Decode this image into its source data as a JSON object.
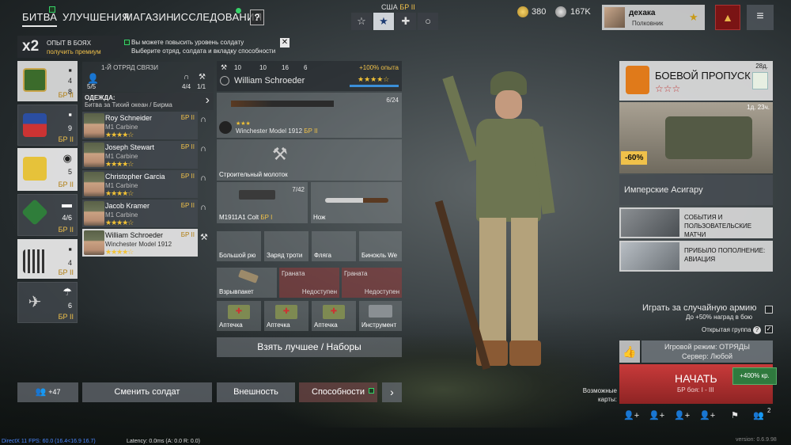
{
  "nav": {
    "battle": "БИТВА",
    "upgrades": "УЛУЧШЕНИЯ",
    "shop": "МАГАЗИН",
    "research": "ИССЛЕДОВАНИЯ",
    "help": "?"
  },
  "army": {
    "name": "США",
    "rank": "БР II"
  },
  "currency": {
    "gold": "380",
    "silver": "167K"
  },
  "profile": {
    "name": "дехака",
    "rank": "Полковник"
  },
  "boost": {
    "x2": "x2",
    "title": "ОПЫТ В БОЯХ",
    "subtitle": "получить премиум"
  },
  "notice": {
    "text": "Вы можете повысить уровень солдату\nВыберите отряд, солдата и вкладку способности"
  },
  "squads": [
    {
      "count": "4",
      "men": "8",
      "rank": "БР II"
    },
    {
      "count": "9",
      "rank": "БР II"
    },
    {
      "count": "5",
      "rank": "БР II"
    },
    {
      "count": "4/6",
      "rank": "БР II"
    },
    {
      "count": "4",
      "rank": "БР II"
    },
    {
      "count": "6",
      "rank": "БР II"
    }
  ],
  "squad_info": {
    "title": "1-Й ОТРЯД СВЯЗИ",
    "size": "5/5",
    "radio": "4/4",
    "eng": "1/1"
  },
  "outfit": {
    "title": "ОДЕЖДА:",
    "subtitle": "Битва за Тихий океан / Бирма"
  },
  "soldiers": [
    {
      "name": "Roy Schneider",
      "weapon": "M1 Carbine",
      "rank": "БР II",
      "stars": "★★★★☆"
    },
    {
      "name": "Joseph Stewart",
      "weapon": "M1 Carbine",
      "rank": "БР II",
      "stars": "★★★★☆"
    },
    {
      "name": "Christopher Garcia",
      "weapon": "M1 Carbine",
      "rank": "БР II",
      "stars": "★★★★☆"
    },
    {
      "name": "Jacob Kramer",
      "weapon": "M1 Carbine",
      "rank": "БР II",
      "stars": "★★★★☆"
    },
    {
      "name": "William Schroeder",
      "weapon": "Winchester Model 1912",
      "rank": "БР II",
      "stars": "★★★★☆"
    }
  ],
  "detail": {
    "stat1": "10",
    "stat2": "10",
    "stat3": "16",
    "stat4": "6",
    "exp": "+100% опыта",
    "name": "William Schroeder",
    "stars": "★★★★☆"
  },
  "slots": {
    "primary": {
      "name": "Winchester Model 1912",
      "rank": "БР II",
      "ammo": "6/24",
      "stars": "★★★"
    },
    "tool": {
      "name": "Строительный молоток"
    },
    "pistol": {
      "name": "M1911A1 Colt",
      "rank": "БР I",
      "ammo": "7/42"
    },
    "knife": {
      "name": "Нож"
    },
    "gear": [
      "Большой рю",
      "Заряд троти",
      "Фляга",
      "Бинокль We"
    ],
    "grenade1": {
      "name": "Взрывпакет"
    },
    "grenade2": {
      "name": "Граната",
      "status": "Недоступен"
    },
    "grenade3": {
      "name": "Граната",
      "status": "Недоступен"
    },
    "items": [
      "Аптечка",
      "Аптечка",
      "Аптечка",
      "Инструмент"
    ]
  },
  "take_best": "Взять лучшее / Наборы",
  "bottom": {
    "recruit": "+47",
    "change": "Сменить солдат",
    "appearance": "Внешность",
    "abilities": "Способности",
    "next": "›"
  },
  "battlepass": {
    "title": "БОЕВОЙ ПРОПУСК",
    "time": "28д.",
    "stars": "☆☆☆"
  },
  "offer": {
    "discount": "-60%",
    "time": "1д. 23ч.",
    "name": "Имперские Асигару"
  },
  "news": [
    {
      "title": "СОБЫТИЯ И ПОЛЬЗОВАТЕЛЬСКИЕ МАТЧИ"
    },
    {
      "title": "ПРИБЫЛО ПОПОЛНЕНИЕ: АВИАЦИЯ"
    }
  ],
  "options": {
    "random_army": "Играть за случайную армию",
    "bonus": "До +50% наград в бою",
    "open_group": "Открытая группа"
  },
  "mode": {
    "mode": "Игровой режим: ОТРЯДЫ",
    "server": "Сервер: Любой"
  },
  "start": {
    "label": "НАЧАТЬ",
    "sub": "БР боя: I - III",
    "bonus": "+400% кр."
  },
  "maps": "Возможные карты:",
  "group_count": "2",
  "debug": "DirectX 11 FPS: 60.0 (16.4<16.9 16.7)",
  "latency": "Latency: 0.0ms (A: 0.0 R: 0.0)",
  "version": "version: 0.6.9.98"
}
